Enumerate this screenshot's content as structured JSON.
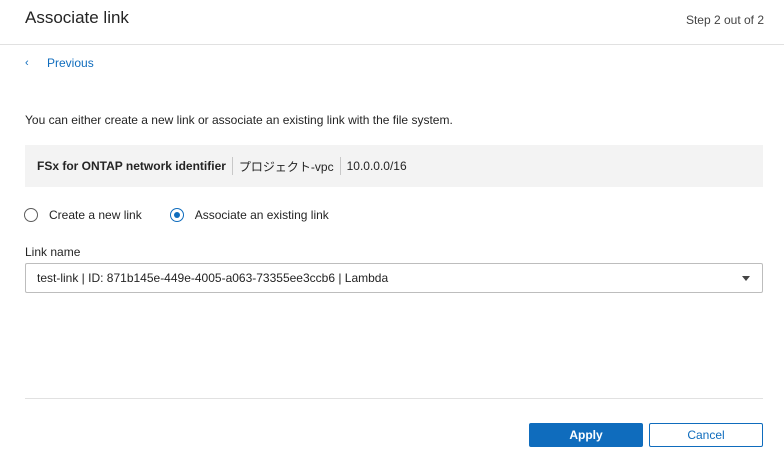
{
  "dialog": {
    "title": "Associate link",
    "step": "Step 2 out of 2"
  },
  "nav": {
    "previous_label": "Previous",
    "previous_icon": "chevron-left-icon"
  },
  "description": "You can either create a new link or associate an existing link with the file system.",
  "identifier": {
    "label": "FSx for ONTAP network identifier",
    "vpc_name": "プロジェクト-vpc",
    "cidr": "10.0.0.0/16"
  },
  "link_mode": {
    "options": [
      {
        "label": "Create a new link",
        "selected": false
      },
      {
        "label": "Associate an existing link",
        "selected": true
      }
    ]
  },
  "link_select": {
    "label": "Link name",
    "value": "test-link | ID: 871b145e-449e-4005-a063-73355ee3ccb6 | Lambda",
    "icon": "caret-down-icon"
  },
  "footer": {
    "apply_label": "Apply",
    "cancel_label": "Cancel"
  },
  "colors": {
    "accent": "#0f6cbd",
    "info_background": "#f3f3f3",
    "divider": "#e1e1e1"
  }
}
